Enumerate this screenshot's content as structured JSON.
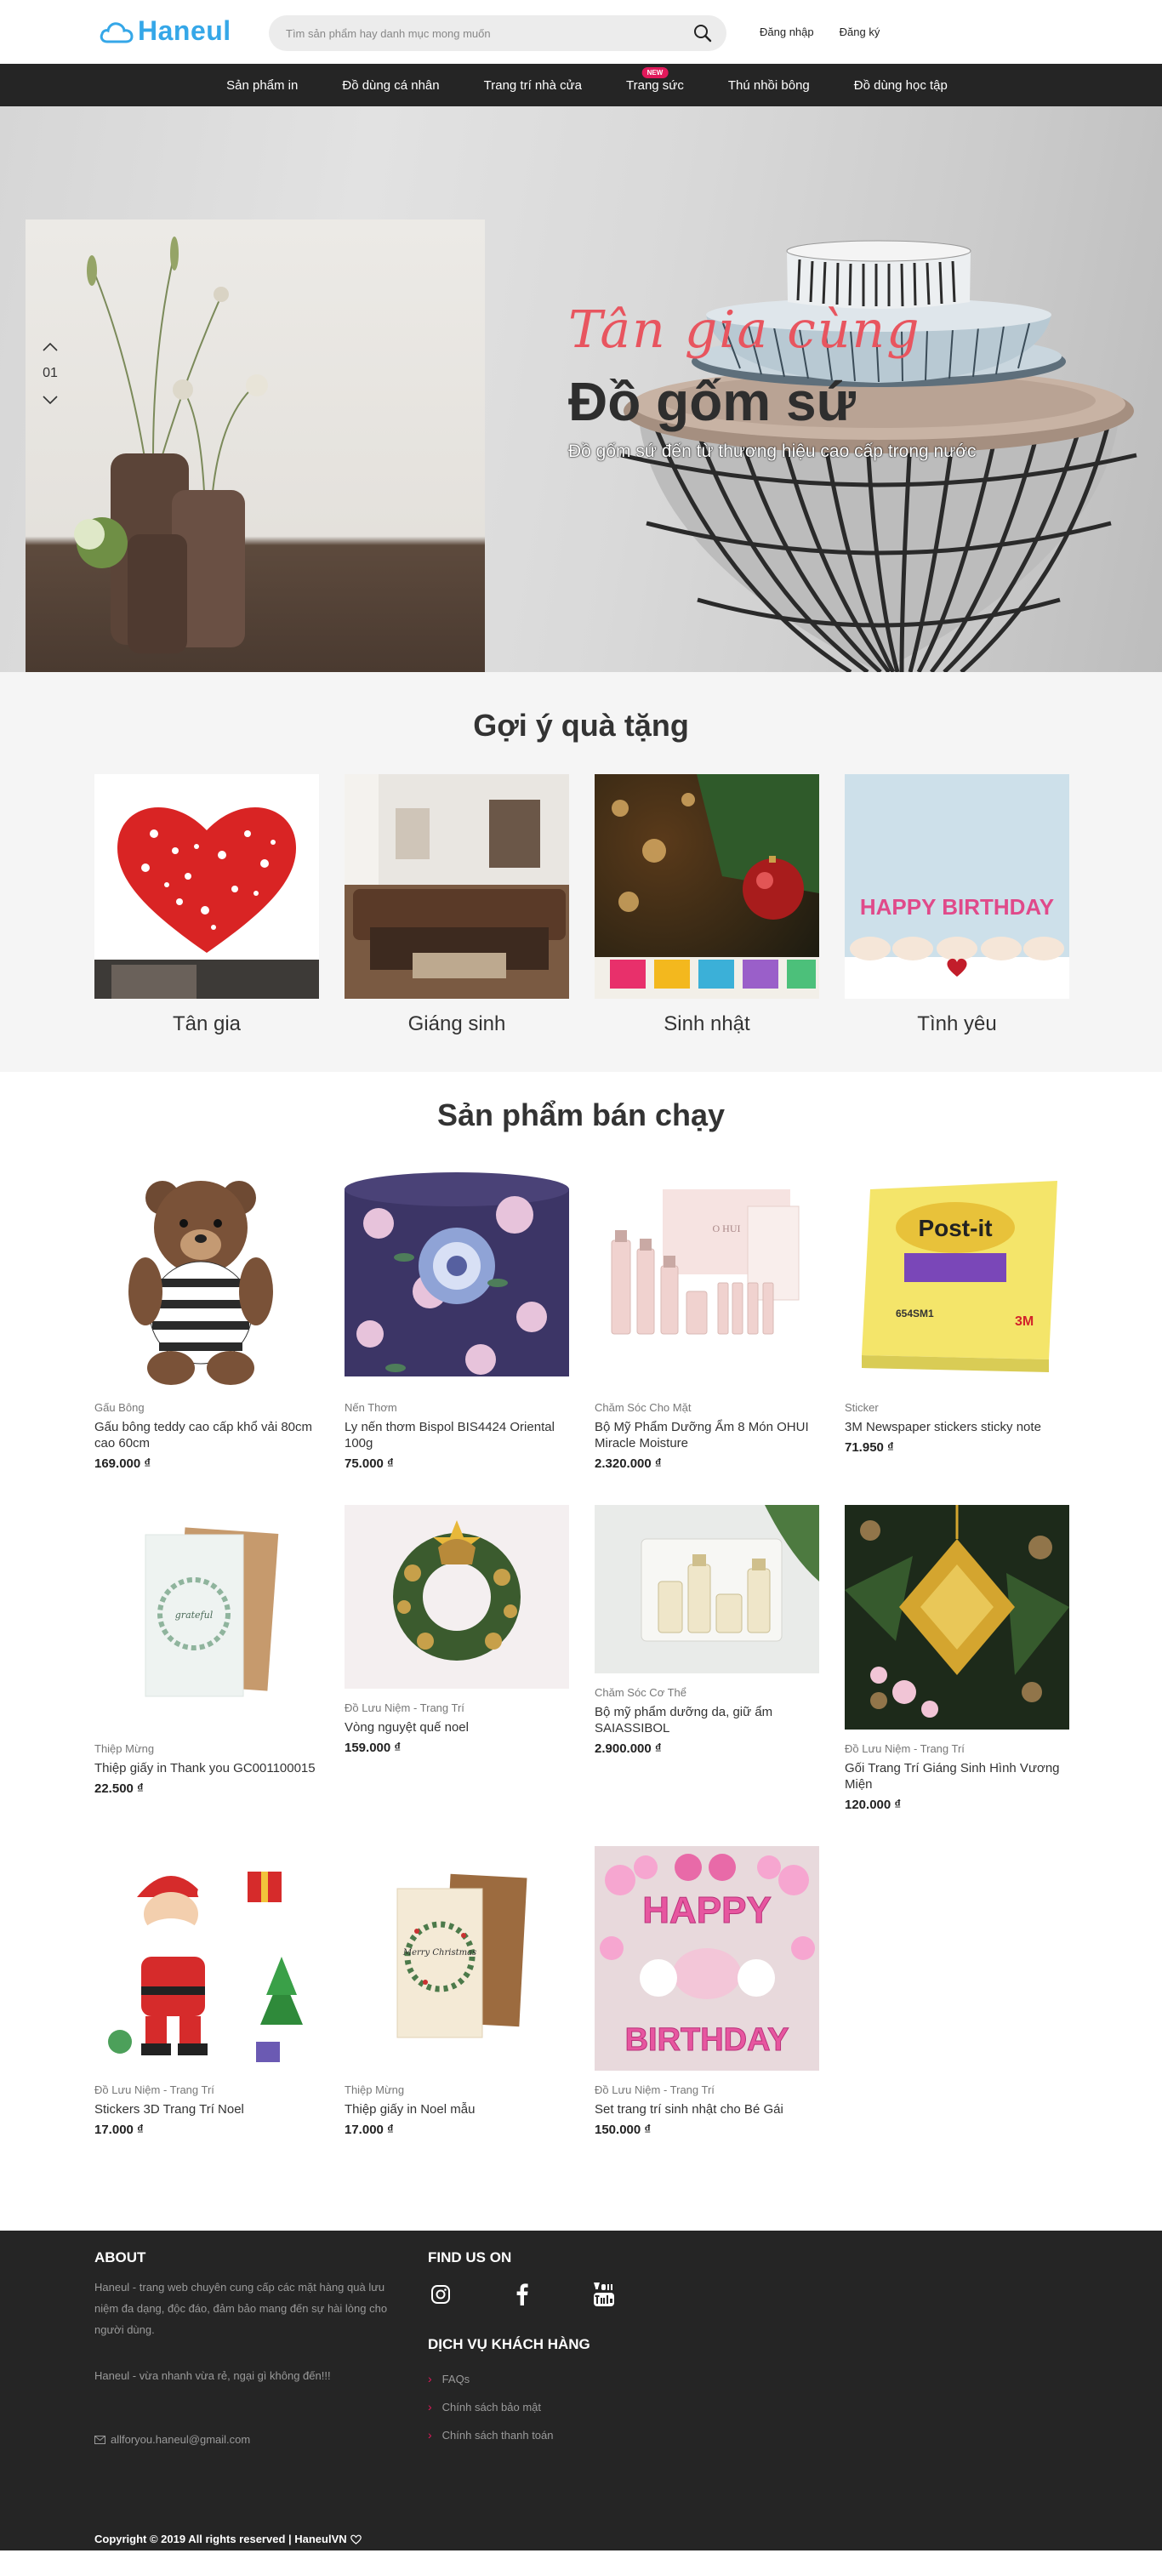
{
  "header": {
    "logo_text": "Haneul",
    "search_placeholder": "Tìm sản phẩm hay danh mục mong muốn",
    "login_label": "Đăng nhập",
    "register_label": "Đăng ký"
  },
  "nav": {
    "items": [
      {
        "label": "Sản phẩm in"
      },
      {
        "label": "Đồ dùng cá nhân"
      },
      {
        "label": "Trang trí nhà cửa"
      },
      {
        "label": "Trang sức",
        "badge": "NEW"
      },
      {
        "label": "Thú nhồi bông"
      },
      {
        "label": "Đồ dùng học tập"
      }
    ]
  },
  "hero": {
    "index": "01",
    "script_title": "Tân gia cùng",
    "title": "Đồ gốm sứ",
    "subtitle": "Đồ gốm sứ đến từ thương hiệu cao cấp trong nước"
  },
  "gift": {
    "title": "Gợi ý quà tặng",
    "items": [
      {
        "label": "Tân gia"
      },
      {
        "label": "Giáng sinh"
      },
      {
        "label": "Sinh nhật"
      },
      {
        "label": "Tình yêu"
      }
    ]
  },
  "best": {
    "title": "Sản phẩm bán chạy",
    "products": [
      {
        "category": "Gấu Bông",
        "name": "Gấu bông teddy cao cấp khổ vải 80cm cao 60cm",
        "price": "169.000 ₫"
      },
      {
        "category": "Nến Thơm",
        "name": "Ly nến thơm Bispol BIS4424 Oriental 100g",
        "price": "75.000 ₫"
      },
      {
        "category": "Chăm Sóc Cho Mặt",
        "name": "Bộ Mỹ Phẩm Dưỡng Ẩm 8 Món OHUI Miracle Moisture",
        "price": "2.320.000 ₫"
      },
      {
        "category": "Sticker",
        "name": "3M Newspaper stickers sticky note",
        "price": "71.950 ₫"
      },
      {
        "category": "Thiệp Mừng",
        "name": "Thiệp giấy in Thank you GC001100015",
        "price": "22.500 ₫"
      },
      {
        "category": "Đồ Lưu Niệm - Trang Trí",
        "name": "Vòng nguyệt quế noel",
        "price": "159.000 ₫"
      },
      {
        "category": "Chăm Sóc Cơ Thể",
        "name": "Bộ mỹ phẩm dưỡng da, giữ ẩm SAIASSIBOL",
        "price": "2.900.000 ₫"
      },
      {
        "category": "Đồ Lưu Niệm - Trang Trí",
        "name": "Gối Trang Trí Giáng Sinh Hình Vương Miện",
        "price": "120.000 ₫"
      },
      {
        "category": "Đồ Lưu Niệm - Trang Trí",
        "name": "Stickers 3D Trang Trí Noel",
        "price": "17.000 ₫"
      },
      {
        "category": "Thiệp Mừng",
        "name": "Thiệp giấy in Noel mẫu",
        "price": "17.000 ₫"
      },
      {
        "category": "Đồ Lưu Niệm - Trang Trí",
        "name": "Set trang trí sinh nhật cho Bé Gái",
        "price": "150.000 ₫"
      }
    ]
  },
  "images": {
    "postit_brand": "Post-it",
    "postit_code": "654SM1",
    "postit_3m": "3M",
    "birthday_cake_text": "HAPPY BIRTHDAY",
    "card_thank": "grateful",
    "card_merry": "Merry Christmas",
    "balloon_happy": "HAPPY",
    "balloon_birthday": "BIRTHDAY",
    "ohui_brand": "O HUI"
  },
  "footer": {
    "about_title": "ABOUT",
    "about_text": "Haneul - trang web chuyên cung cấp các mặt hàng quà lưu niệm đa dạng, độc đáo, đảm bảo mang đến sự hài lòng cho người dùng.",
    "slogan": "Haneul - vừa nhanh vừa rẻ, ngại gì không đến!!!",
    "email": "allforyou.haneul@gmail.com",
    "find_us_title": "FIND US ON",
    "service_title": "DỊCH VỤ KHÁCH HÀNG",
    "service_links": [
      "FAQs",
      "Chính sách bảo mật",
      "Chính sách thanh toán"
    ],
    "copyright": "Copyright © 2019 All rights reserved | HaneulVN"
  },
  "colors": {
    "brand": "#35a7e8",
    "nav_bg": "#252525",
    "badge": "#e2195b",
    "hero_script": "#e8555f"
  }
}
